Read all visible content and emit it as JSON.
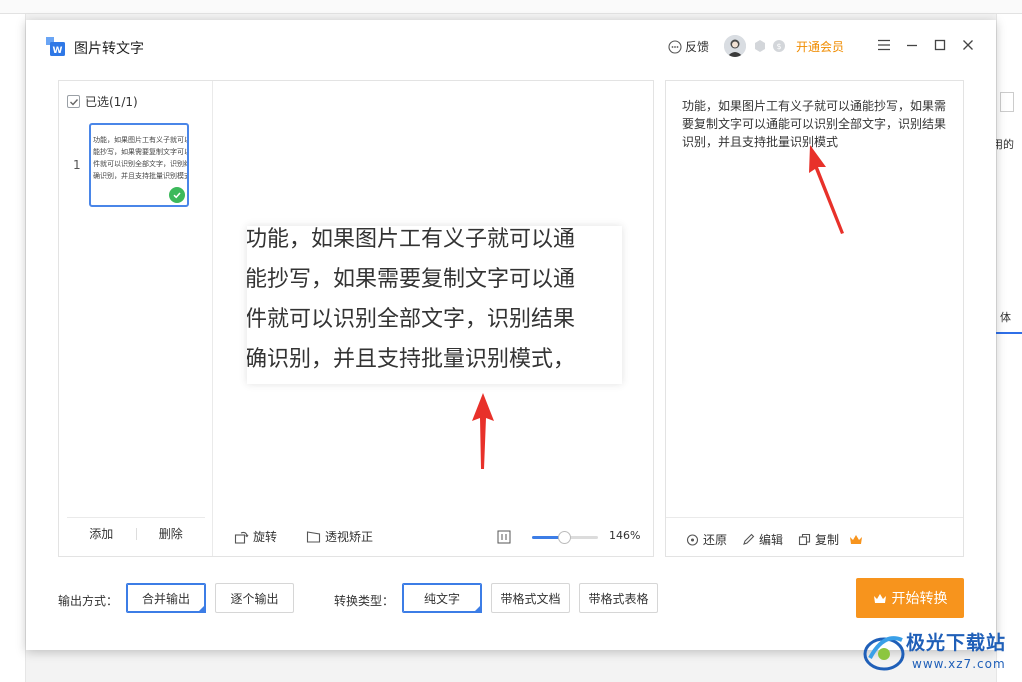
{
  "background": {
    "right_text_1": "用的",
    "right_text_2": "体"
  },
  "dialog": {
    "title": "图片转文字",
    "feedback_label": "反馈",
    "vip_label": "开通会员",
    "icons": [
      "app-icon",
      "feedback-icon",
      "avatar",
      "badge-icon",
      "badge-icon",
      "menu-icon",
      "minimize-icon",
      "maximize-icon",
      "close-icon"
    ]
  },
  "thumbnails": {
    "selected_label": "已选(1/1)",
    "items": [
      {
        "index": "1",
        "lines": [
          "功能，如果图片工有义子就可以通能",
          "能抄写，如果需要复制文字可以通",
          "件就可以识别全部文字，识别结果",
          "确识别，并且支持批量识别模式，"
        ]
      }
    ],
    "add_label": "添加",
    "delete_label": "删除"
  },
  "preview": {
    "lines": [
      "功能，如果图片工有义子就可以通",
      "能抄写，如果需要复制文字可以通",
      "件就可以识别全部文字，识别结果",
      "确识别，并且支持批量识别模式，"
    ],
    "rotate_label": "旋转",
    "perspective_label": "透视矫正",
    "zoom_label": "146%",
    "zoom_fraction": 0.48
  },
  "result": {
    "text": "功能，如果图片工有义子就可以通能抄写，如果需要复制文字可以通能可以识别全部文字，识别结果识别，并且支持批量识别模式",
    "restore_label": "还原",
    "edit_label": "编辑",
    "copy_label": "复制"
  },
  "output": {
    "label": "输出方式：",
    "merge_label": "合并输出",
    "single_label": "逐个输出",
    "selected": "合并输出"
  },
  "convert": {
    "label": "转换类型：",
    "plain_label": "纯文字",
    "formatted_doc_label": "带格式文档",
    "formatted_table_label": "带格式表格",
    "selected": "纯文字"
  },
  "start_button_label": "开始转换",
  "watermark": {
    "name": "极光下载站",
    "url": "www.xz7.com"
  },
  "colors": {
    "accent": "#3c7de6",
    "start": "#f7941d",
    "vip": "#f08c00",
    "success": "#3cb95b",
    "arrow": "#e8312a"
  }
}
